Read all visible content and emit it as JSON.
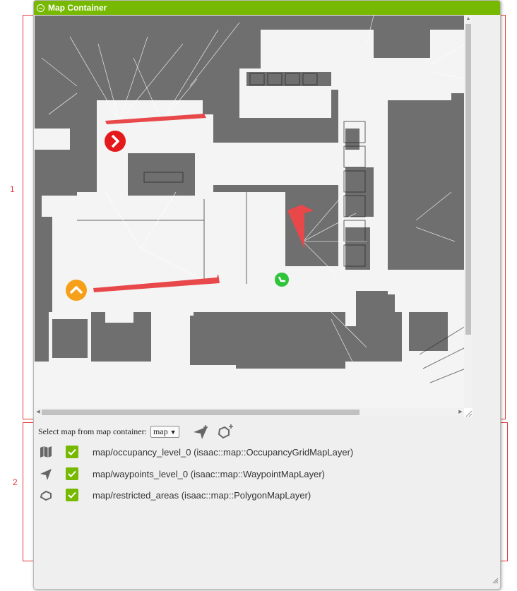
{
  "window": {
    "title": "Map Container"
  },
  "map_selector": {
    "label": "Select map from map container:",
    "selected": "map",
    "options": [
      "map"
    ]
  },
  "toolbar": {
    "icons": [
      "add-waypoint-icon",
      "add-polygon-icon"
    ]
  },
  "layers": [
    {
      "icon": "map-icon",
      "checked": true,
      "label": "map/occupancy_level_0 (isaac::map::OccupancyGridMapLayer)"
    },
    {
      "icon": "waypoint-arrow-icon",
      "checked": true,
      "label": "map/waypoints_level_0 (isaac::map::WaypointMapLayer)"
    },
    {
      "icon": "polygon-icon",
      "checked": true,
      "label": "map/restricted_areas (isaac::map::PolygonMapLayer)"
    }
  ],
  "annotations": {
    "box1": "1",
    "box2": "2"
  },
  "colors": {
    "accent": "#76b900",
    "annotation": "#e53a3a"
  }
}
